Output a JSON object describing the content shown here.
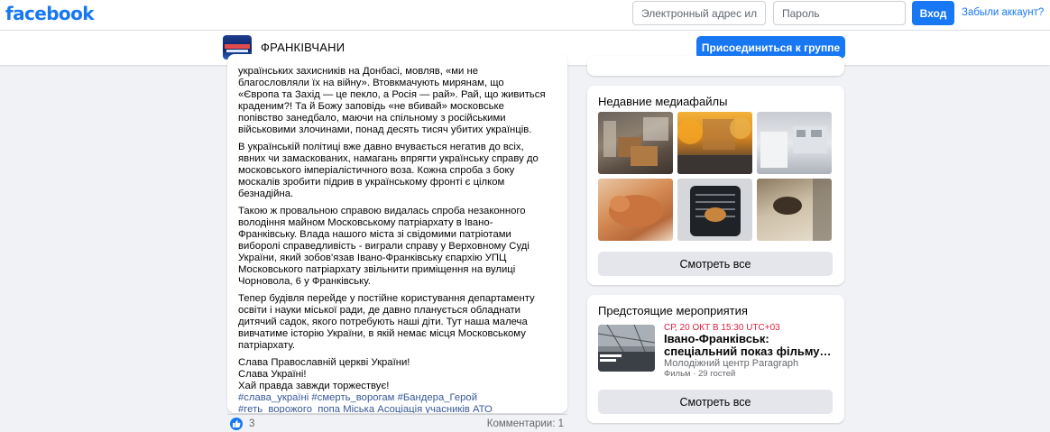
{
  "topbar": {
    "logo": "facebook",
    "email_placeholder": "Электронный адрес ил",
    "password_placeholder": "Пароль",
    "login_label": "Вход",
    "forgot_label": "Забыли аккаунт?"
  },
  "group": {
    "name": "ФРАНКІВЧАНИ",
    "join_label": "Присоединиться к группе"
  },
  "post": {
    "lines_p1": [
      "українських захисників на Донбасі, мовляв, «ми не",
      "благословляли їх на війну». Втовкмачують мирянам, що",
      "«Європа та Захід — це пекло, а Росія — рай». Рай, що живиться",
      "краденим?! Та й Божу заповідь «не вбивай» московське",
      "попівство занедбало, маючи на спільному з російськими",
      "військовими злочинами, понад десять тисяч убитих українців."
    ],
    "lines_p2": [
      "В українській політиці вже давно вчувається негатив до всіх,",
      "явних чи замаскованих, намагань впрягти українську справу до",
      "московського імперіалістичного воза. Кожна спроба з боку",
      "москалів зробити підрив в українському фронті є цілком",
      "безнадійна."
    ],
    "lines_p3": [
      "Такою ж провальною справою видалась спроба незаконного",
      "володіння майном Московському патріархату в Івано-",
      "Франківську. Влада нашого міста зі свідомими патріотами",
      "виборолі справедливість - виграли справу у Верховному Суді",
      "України, який зобов'язав Івано-Франківську єпархію УПЦ",
      "Московського патріархату звільнити приміщення на вулиці",
      "Чорновола, 6 у Франківську."
    ],
    "lines_p4": [
      "Тепер будівля перейде у постійне користування департаменту",
      "освіти і науки міської ради, де давно планується обладнати",
      "дитячий садок, якого потребують наші діти. Тут наша малеча",
      "вивчатиме історію України, в якій немає місця Московському",
      "патріархату."
    ],
    "lines_p5": [
      "Слава Православній церкві України!",
      "Слава Україні!",
      "Хай правда завжди торжествує!"
    ],
    "hashtags": [
      "#слава_україні #смерть_ворогам #Бандера_Герой",
      "#геть_ворожого_попа Міська Асоціація учасників АТО"
    ],
    "likes": "3",
    "comments_label": "Комментарии: 1"
  },
  "media": {
    "title": "Недавние медиафайлы",
    "photos": [
      {
        "name": "photo-room-boxes"
      },
      {
        "name": "photo-autumn-building"
      },
      {
        "name": "photo-kitchen-interior"
      },
      {
        "name": "photo-ginger-cat"
      },
      {
        "name": "photo-pet-carrier"
      },
      {
        "name": "photo-dog-on-floor"
      }
    ],
    "see_all_label": "Смотреть все"
  },
  "events": {
    "title": "Предстоящие мероприятия",
    "date": "СР, 20 ОКТ В 15:30 UTC+03",
    "event_title_line1": "Івано-Франківськ:",
    "event_title_line2": "спеціальний показ фільму…",
    "place": "Молодіжний центр Paragraph",
    "meta": "Фильм · 29 гостей",
    "see_all_label": "Смотреть все"
  },
  "colors": {
    "brand": "#1877f2",
    "background": "#f0f2f5",
    "hashtag": "#385898",
    "event_date": "#e41e3f"
  }
}
